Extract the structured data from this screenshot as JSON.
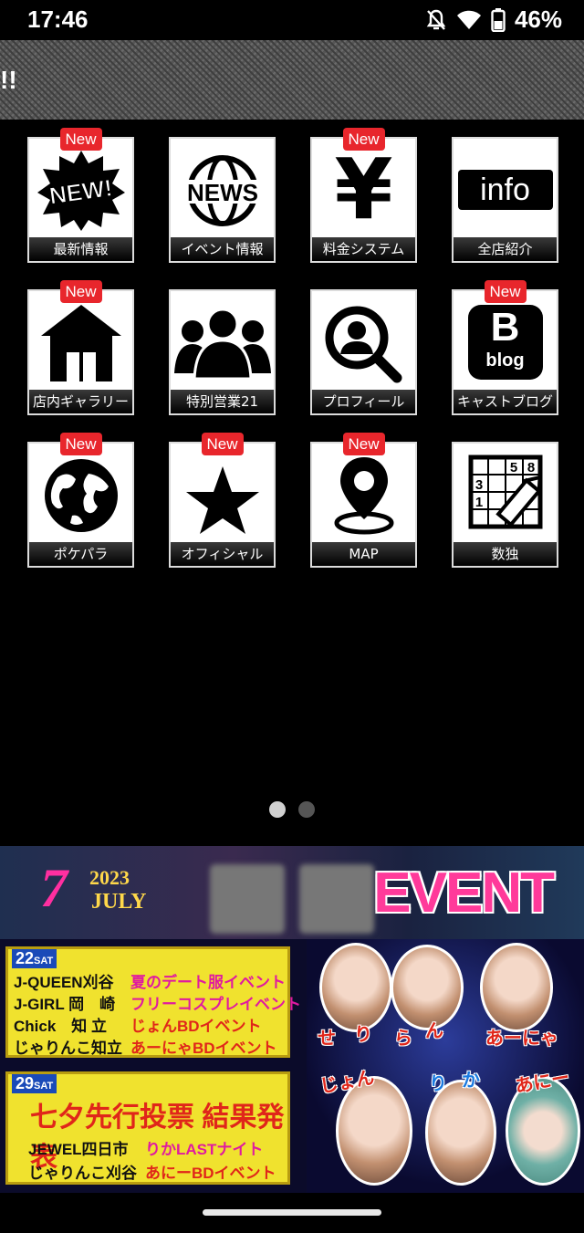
{
  "status_bar": {
    "time": "17:46",
    "battery_pct": "46%",
    "icons": [
      "notifications-off-icon",
      "wifi-icon",
      "battery-icon"
    ]
  },
  "ticker": {
    "text": "!!"
  },
  "grid": {
    "badge_text": "New",
    "tiles": [
      {
        "label": "最新情報",
        "icon": "new-burst-icon",
        "new": true
      },
      {
        "label": "イベント情報",
        "icon": "news-globe-icon",
        "new": false
      },
      {
        "label": "料金システム",
        "icon": "yen-icon",
        "new": true
      },
      {
        "label": "全店紹介",
        "icon": "info-icon",
        "new": false
      },
      {
        "label": "店内ギャラリー",
        "icon": "house-icon",
        "new": true
      },
      {
        "label": "特別営業21",
        "icon": "group-icon",
        "new": false
      },
      {
        "label": "プロフィール",
        "icon": "profile-search-icon",
        "new": false
      },
      {
        "label": "キャストブログ",
        "icon": "blog-icon",
        "new": true
      },
      {
        "label": "ポケパラ",
        "icon": "globe-icon",
        "new": true
      },
      {
        "label": "オフィシャル",
        "icon": "star-icon",
        "new": true
      },
      {
        "label": "MAP",
        "icon": "map-pin-icon",
        "new": true
      },
      {
        "label": "数独",
        "icon": "sudoku-icon",
        "new": false
      }
    ],
    "icon_text": {
      "new": "NEW!",
      "news": "NEWS",
      "yen": "¥",
      "info": "info",
      "blog_letter": "B",
      "blog_word": "blog"
    },
    "sudoku_digits": [
      "5",
      "8",
      "3",
      "1"
    ]
  },
  "pager": {
    "pages": 2,
    "current": 1
  },
  "banner": {
    "month": "7",
    "year": "2023",
    "month_name": "JULY",
    "event": "EVENT",
    "date1": {
      "day": "22",
      "dow": "SAT"
    },
    "rows1": [
      {
        "shop": "J-QUEEN刈谷",
        "event": "夏のデート服イベント"
      },
      {
        "shop": "J-GIRL 岡　崎",
        "event": "フリーコスプレイベント"
      },
      {
        "shop": "Chick　知 立",
        "event": "じょんBDイベント"
      },
      {
        "shop": "じゃりんこ知立",
        "event": "あーにゃBDイベント"
      }
    ],
    "date2": {
      "day": "29",
      "dow": "SAT"
    },
    "headline2": "七夕先行投票 結果発表",
    "rows2": [
      {
        "shop": "JEWEL四日市",
        "event": "りかLASTナイト"
      },
      {
        "shop": "じゃりんこ刈谷",
        "event": "あにーBDイベント"
      }
    ],
    "names": {
      "se": "せ",
      "ri": "り",
      "ra": "ら",
      "n": "ん",
      "anya": "あーにゃ",
      "jon": "じょん",
      "ri2": "り",
      "ka": "か",
      "ani": "あにー"
    },
    "colors": {
      "pink": "#ff3a9a",
      "yellow": "#f0e22e",
      "blue": "#1a4ab8"
    }
  }
}
